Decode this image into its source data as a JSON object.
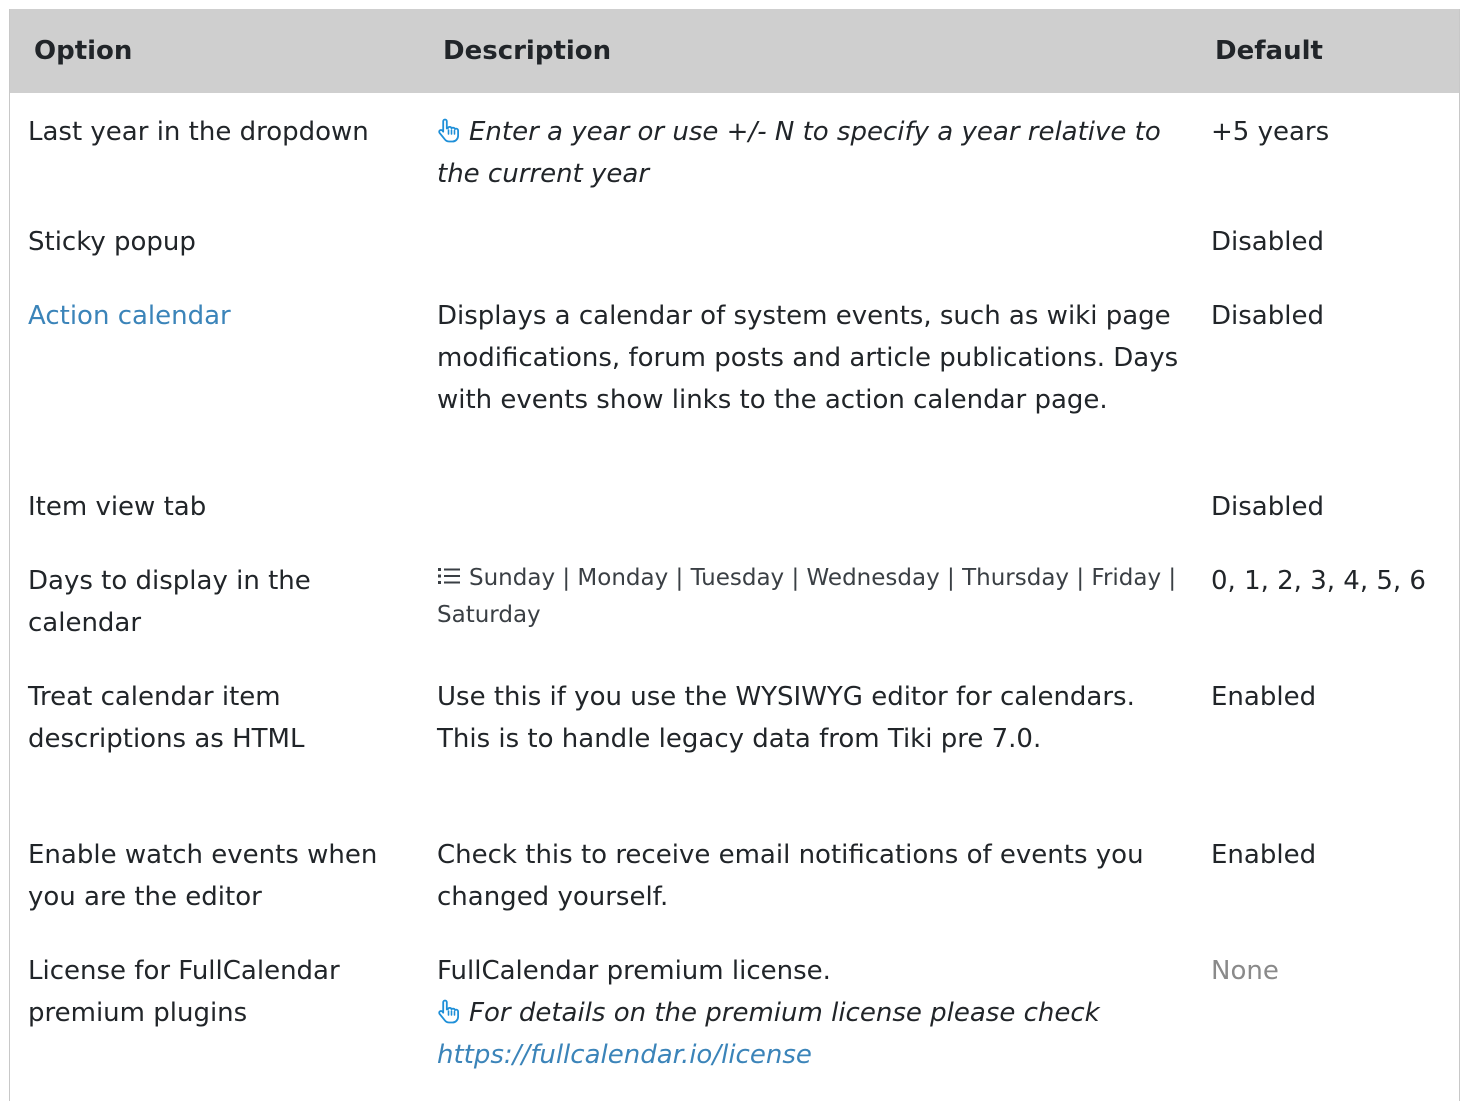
{
  "table": {
    "headers": {
      "option": "Option",
      "description": "Description",
      "default": "Default"
    },
    "rows": [
      {
        "option": "Last year in the dropdown",
        "hint": "Enter a year or use +/- N to specify a year relative to the current year",
        "default": "+5 years"
      },
      {
        "option": "Sticky popup",
        "default": "Disabled"
      },
      {
        "option": "Action calendar",
        "description": "Displays a calendar of system events, such as wiki page modifications, forum posts and article publications. Days with events show links to the action calendar page.",
        "default": "Disabled"
      },
      {
        "option": "Item view tab",
        "default": "Disabled"
      },
      {
        "option": "Days to display in the calendar",
        "days": "Sunday | Monday | Tuesday | Wednesday | Thursday | Friday | Saturday",
        "default": "0, 1, 2, 3, 4, 5, 6"
      },
      {
        "option": "Treat calendar item descriptions as HTML",
        "description": "Use this if you use the WYSIWYG editor for calendars. This is to handle legacy data from Tiki pre 7.0.",
        "default": "Enabled"
      },
      {
        "option": "Enable watch events when you are the editor",
        "description": "Check this to receive email notifications of events you changed yourself.",
        "default": "Enabled"
      },
      {
        "option": "License for FullCalendar premium plugins",
        "description": "FullCalendar premium license.",
        "hint_prefix": "For details on the premium license please check",
        "hint_link": "https://fullcalendar.io/license",
        "default": "None"
      }
    ]
  },
  "colors": {
    "header_bg": "#cfcfcf",
    "link": "#3b84b9",
    "icon": "#1e8fd8",
    "muted": "#8a8a8a"
  },
  "icons": {
    "hint": "pointing-hand-icon",
    "list": "list-icon"
  }
}
